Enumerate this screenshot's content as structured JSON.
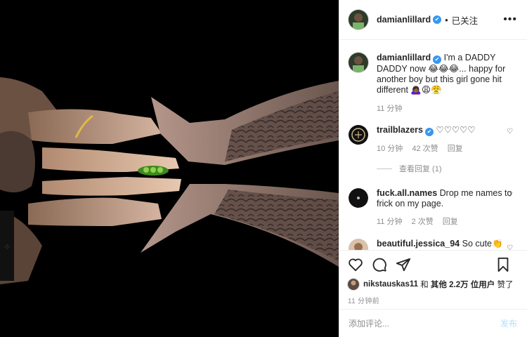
{
  "header": {
    "username": "damianlillard",
    "verified_glyph": "✔",
    "separator": "•",
    "follow_status": "已关注",
    "more_glyph": "•••"
  },
  "caption": {
    "username": "damianlillard",
    "text": "I'm a DADDY DADDY now 😂😂😂... happy for another boy but this girl gone hit different 🙇🏾‍♀️😩😤",
    "time": "11 分钟"
  },
  "comments": [
    {
      "username": "trailblazers",
      "verified": true,
      "text": "♡♡♡♡♡",
      "time": "10 分钟",
      "likes": "42 次赞",
      "reply": "回复",
      "view_replies": "查看回复 (1)"
    },
    {
      "username": "fuck.all.names",
      "verified": false,
      "text": "Drop me names to frick on my page.",
      "time": "11 分钟",
      "likes": "2 次赞",
      "reply": "回复"
    },
    {
      "username": "beautiful.jessica_94",
      "verified": false,
      "text": "So cute👏"
    }
  ],
  "likes": {
    "prefix": "nikstauskas11",
    "connector": "和",
    "others": "其他 2.2万 位用户",
    "suffix": "赞了"
  },
  "post_time": "11 分钟前",
  "add_comment": {
    "placeholder": "添加评论...",
    "post_label": "发布"
  },
  "icons": {
    "like": "heart-icon",
    "comment": "comment-icon",
    "share": "paper-plane-icon",
    "save": "bookmark-icon",
    "comment_like": "heart-outline-icon"
  },
  "colors": {
    "verified": "#3897f0",
    "post_button": "#b2dffc",
    "meta_text": "#8e8e8e",
    "photo_bg": "#000000"
  }
}
